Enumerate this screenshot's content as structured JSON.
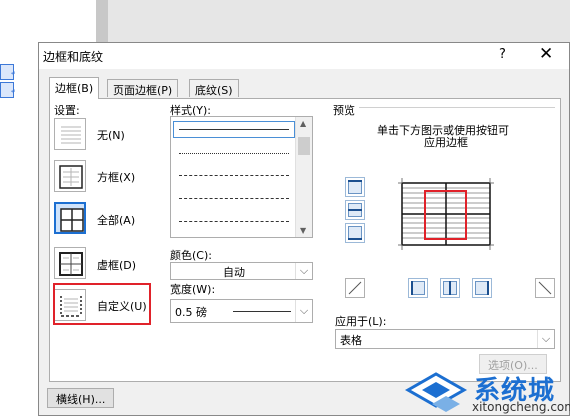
{
  "dialog": {
    "title": "边框和底纹",
    "help": "?",
    "close": "✕"
  },
  "tabs": [
    {
      "label": "边框(B)",
      "active": true
    },
    {
      "label": "页面边框(P)",
      "active": false
    },
    {
      "label": "底纹(S)",
      "active": false
    }
  ],
  "settings": {
    "label": "设置:",
    "items": [
      {
        "label": "无(N)",
        "selected": false
      },
      {
        "label": "方框(X)",
        "selected": false
      },
      {
        "label": "全部(A)",
        "selected": true
      },
      {
        "label": "虚框(D)",
        "selected": false
      },
      {
        "label": "自定义(U)",
        "selected": false
      }
    ]
  },
  "style": {
    "label": "样式(Y):"
  },
  "color": {
    "label": "颜色(C):",
    "value": "自动"
  },
  "width": {
    "label": "宽度(W):",
    "value": "0.5 磅"
  },
  "preview": {
    "label": "预览",
    "hint_line1": "单击下方图示或使用按钮可",
    "hint_line2": "应用边框"
  },
  "apply_to": {
    "label": "应用于(L):",
    "value": "表格"
  },
  "buttons": {
    "options": "选项(O)...",
    "horizontal_line": "横线(H)..."
  },
  "watermark": {
    "text": "系统城",
    "url": "xitongcheng.com"
  },
  "colors": {
    "accent": "#1c6fd1",
    "highlight": "#e0222a",
    "dialog_bg": "#f0f0f0"
  }
}
